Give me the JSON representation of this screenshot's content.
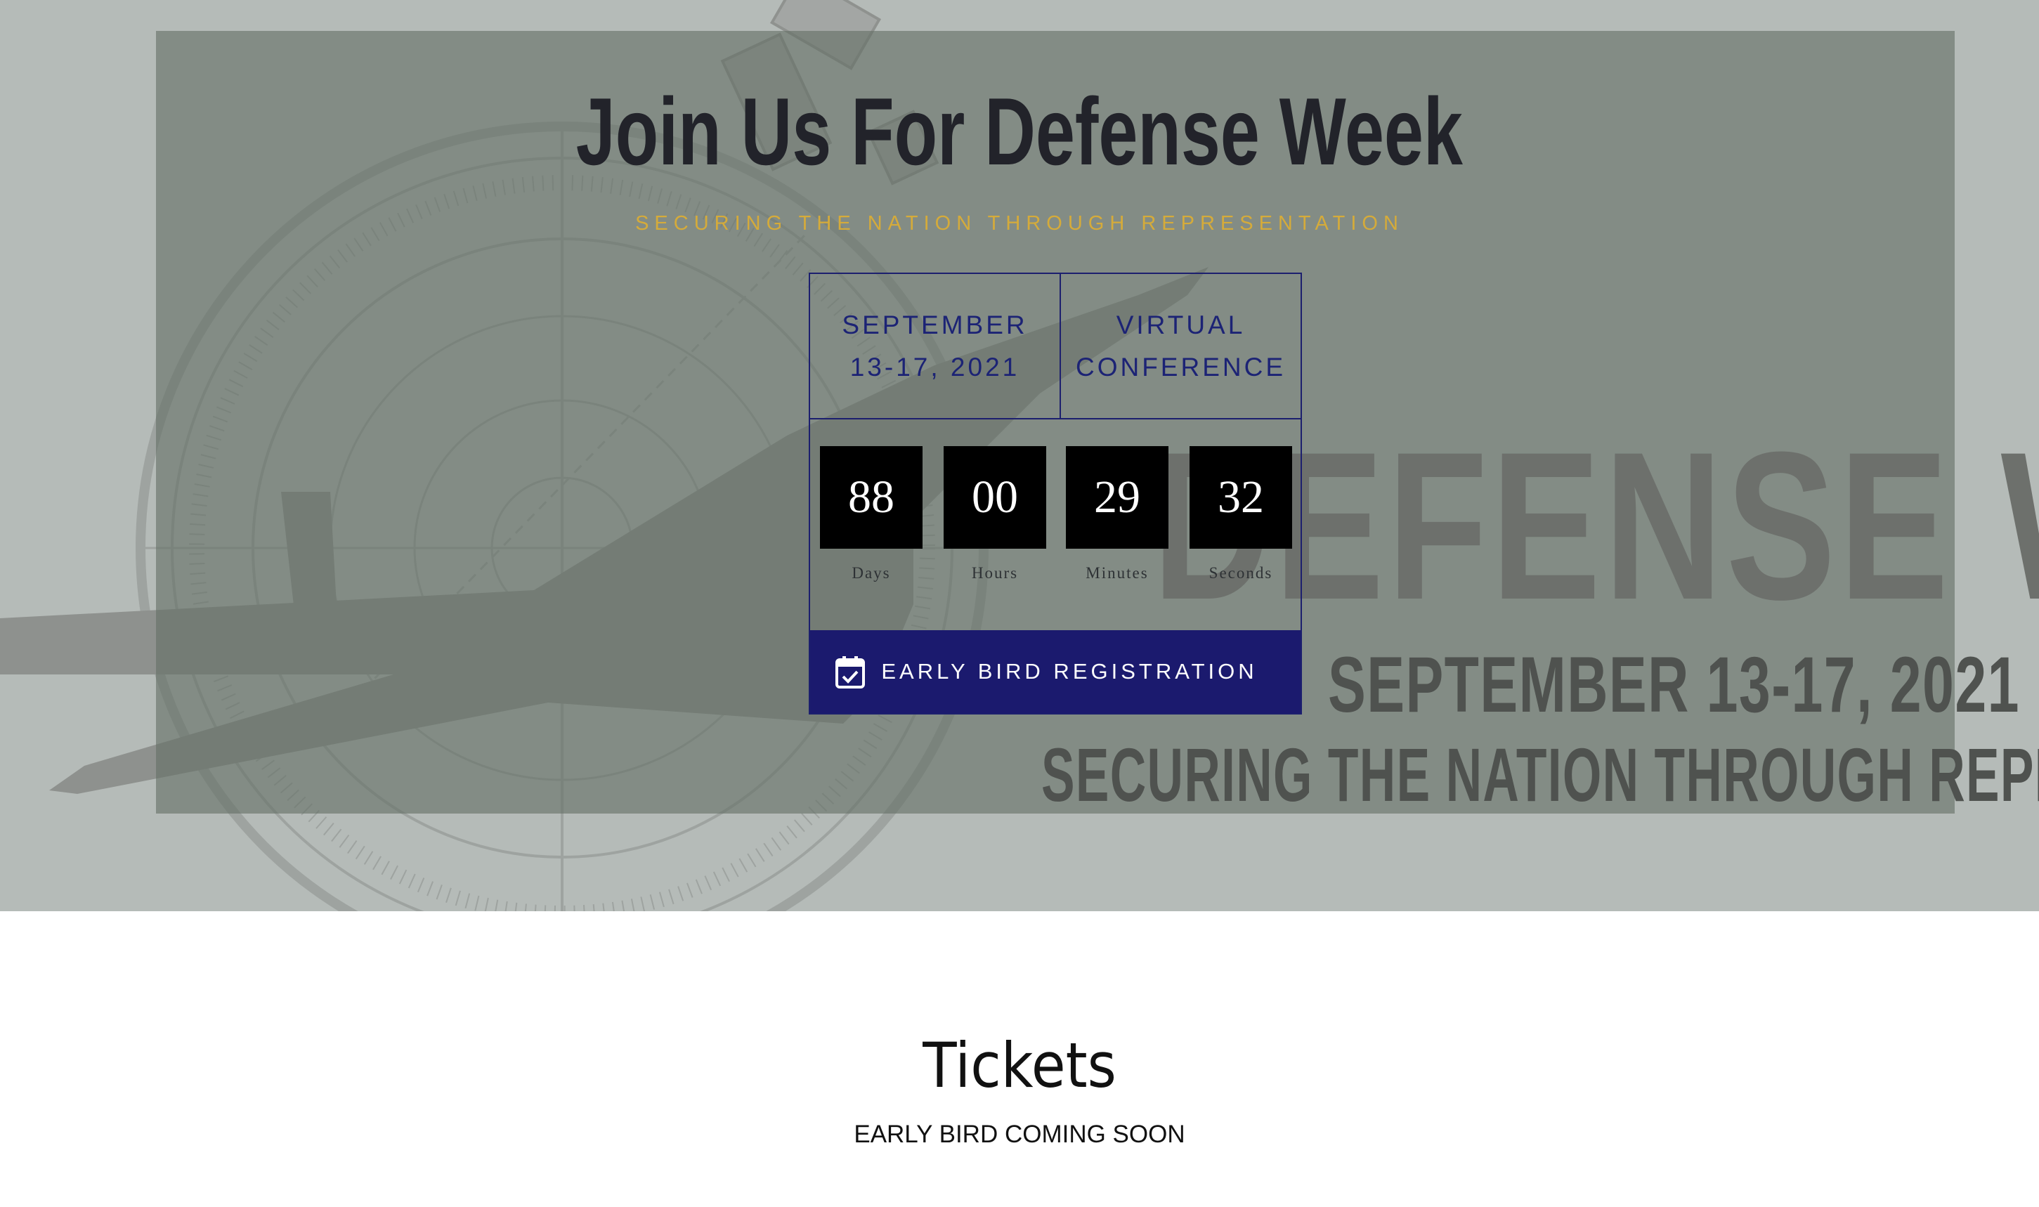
{
  "hero": {
    "title": "Join Us For Defense Week",
    "subtitle": "SECURING THE NATION THROUGH REPRESENTATION",
    "background_text": {
      "headline": "DEFENSE WEE",
      "date": "SEPTEMBER 13-17, 2021",
      "tagline": "SECURING THE NATION THROUGH REPRESE"
    }
  },
  "event": {
    "date_line1": "SEPTEMBER",
    "date_line2": "13-17, 2021",
    "venue_line1": "VIRTUAL",
    "venue_line2": "CONFERENCE"
  },
  "countdown": {
    "days": "88",
    "days_label": "Days",
    "hours": "00",
    "hours_label": "Hours",
    "minutes": "29",
    "minutes_label": "Minutes",
    "seconds": "32",
    "seconds_label": "Seconds"
  },
  "cta": {
    "label": "EARLY BIRD REGISTRATION",
    "icon": "calendar-check-icon"
  },
  "tickets": {
    "title": "Tickets",
    "subtitle": "EARLY BIRD COMING SOON"
  },
  "colors": {
    "accent_blue": "#1b1a6e",
    "subtitle_gold": "#d5ab3a",
    "hero_bg": "#b5bbb8"
  }
}
